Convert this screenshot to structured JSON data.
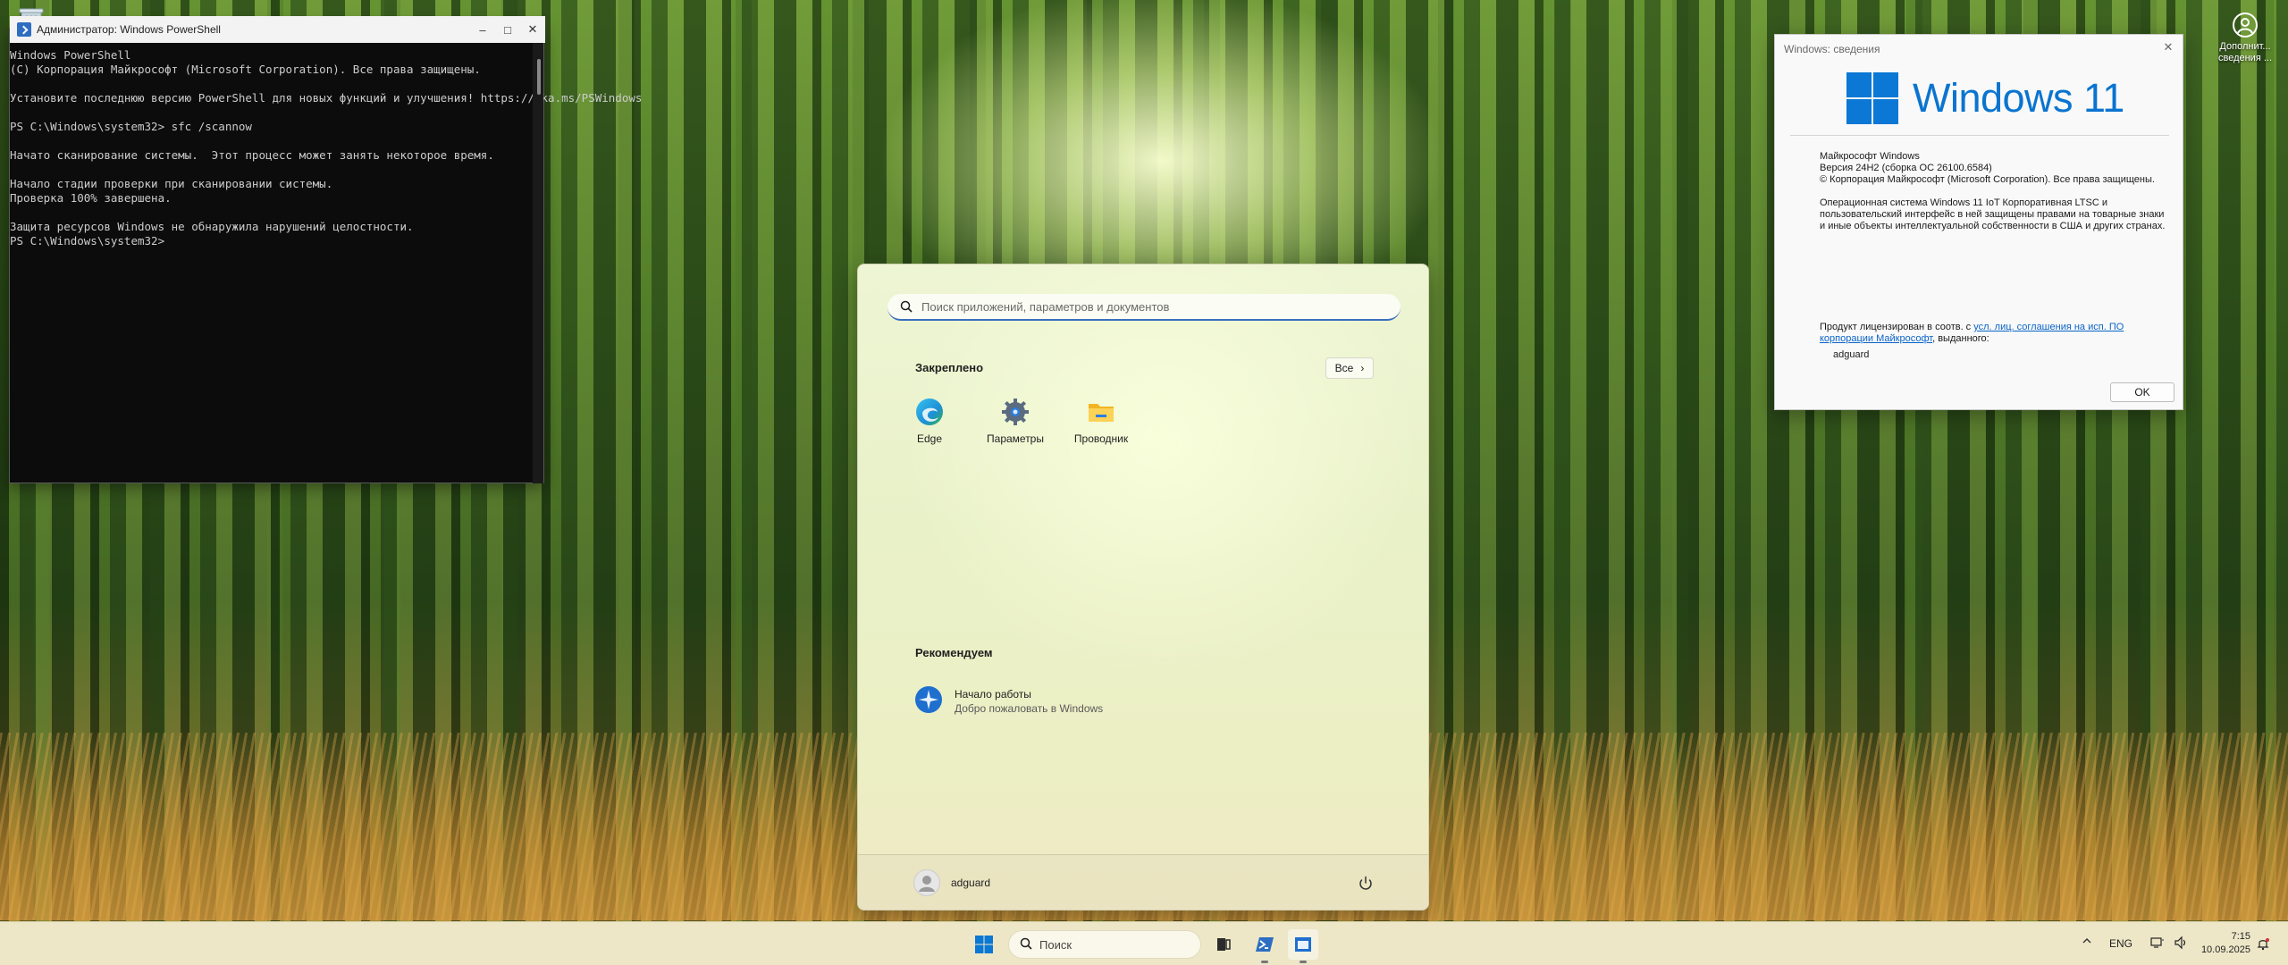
{
  "powershell": {
    "title": "Администратор: Windows PowerShell",
    "lines": [
      "Windows PowerShell",
      "(C) Корпорация Майкрософт (Microsoft Corporation). Все права защищены.",
      "",
      "Установите последнюю версию PowerShell для новых функций и улучшения! https://aka.ms/PSWindows",
      "",
      "PS C:\\Windows\\system32> sfc /scannow",
      "",
      "Начато сканирование системы.  Этот процесс может занять некоторое время.",
      "",
      "Начало стадии проверки при сканировании системы.",
      "Проверка 100% завершена.",
      "",
      "Защита ресурсов Windows не обнаружила нарушений целостности.",
      "PS C:\\Windows\\system32>"
    ]
  },
  "start_menu": {
    "search_placeholder": "Поиск приложений, параметров и документов",
    "pinned_header": "Закреплено",
    "all_label": "Все",
    "pinned_apps": [
      {
        "label": "Edge",
        "icon": "edge-icon"
      },
      {
        "label": "Параметры",
        "icon": "settings-gear-icon"
      },
      {
        "label": "Проводник",
        "icon": "file-explorer-icon"
      }
    ],
    "recommended_header": "Рекомендуем",
    "recommended_item": {
      "title": "Начало работы",
      "subtitle": "Добро пожаловать в Windows",
      "icon": "get-started-icon"
    },
    "user_name": "adguard"
  },
  "winver": {
    "title": "Windows: сведения",
    "wordmark": "Windows 11",
    "line1": "Майкрософт Windows",
    "line2": "Версия 24H2 (сборка ОС 26100.6584)",
    "line3": "© Корпорация Майкрософт (Microsoft Corporation). Все права защищены.",
    "para": "Операционная система Windows 11 IoT Корпоративная LTSC и пользовательский интерфейс в ней защищены правами на товарные знаки и иные объекты интеллектуальной собственности в США и других странах.",
    "license_prefix": "Продукт лицензирован в соотв. с ",
    "license_link": "усл. лиц. соглашения на исп. ПО корпорации Майкрософт",
    "license_suffix": ", выданного:",
    "licensed_user": "adguard",
    "ok_label": "OK"
  },
  "desktop": {
    "extra_icon_label": "Дополнит... сведения ..."
  },
  "taskbar": {
    "search_label": "Поиск",
    "lang": "ENG",
    "time": "7:15",
    "date": "10.09.2025"
  },
  "colors": {
    "accent": "#0a78d4",
    "console_bg": "#0c0c0c",
    "console_fg": "#cccccc"
  }
}
